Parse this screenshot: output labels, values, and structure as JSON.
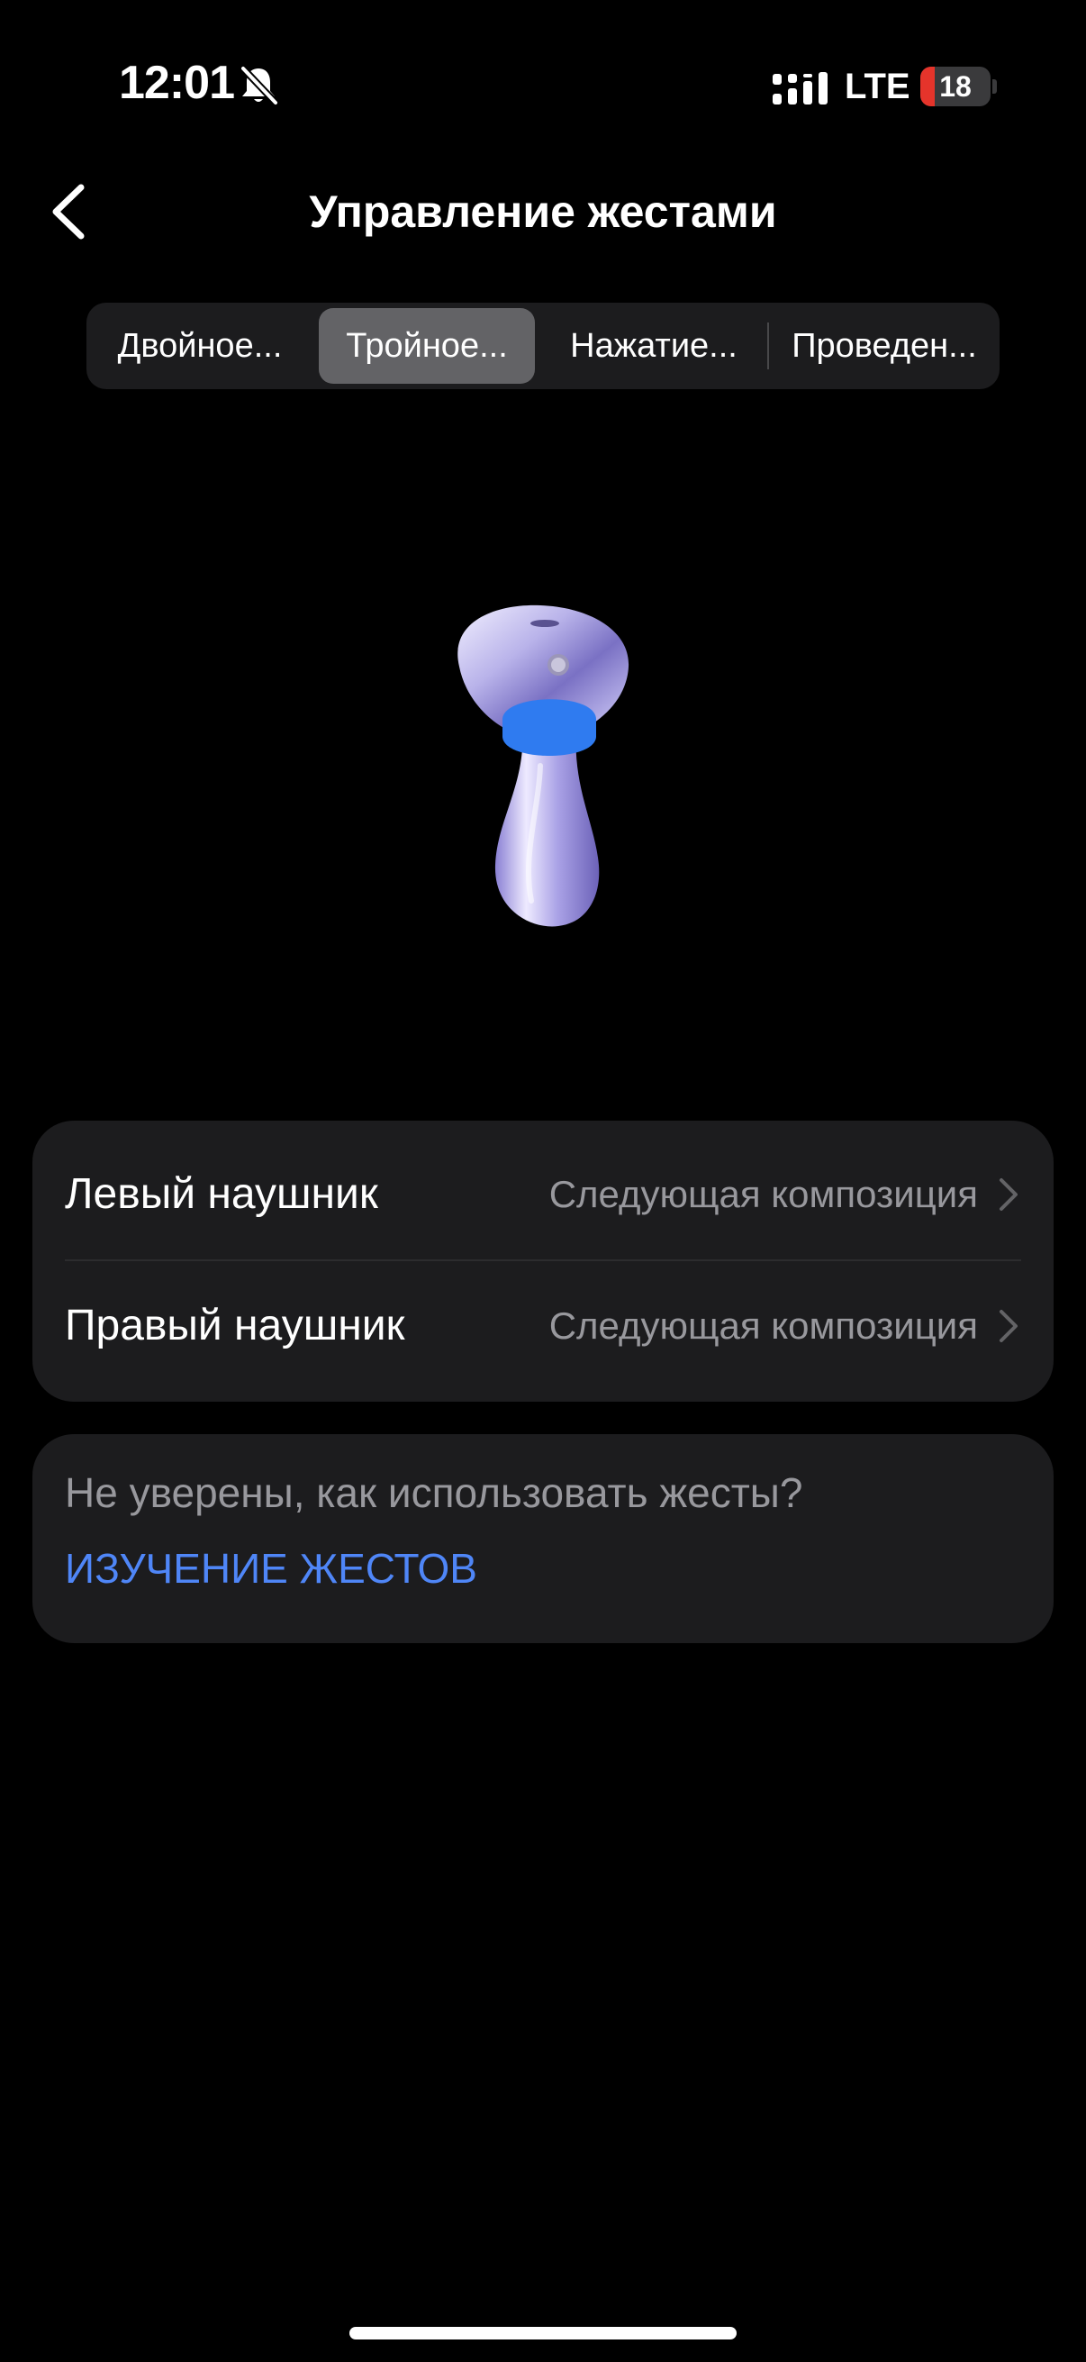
{
  "status_bar": {
    "time": "12:01",
    "network": "LTE",
    "battery_level": "18",
    "battery_color": "#e5342b"
  },
  "nav": {
    "back_icon": "chevron-left-icon",
    "title": "Управление жестами"
  },
  "tabs": [
    {
      "label": "Двойное...",
      "active": false
    },
    {
      "label": "Тройное...",
      "active": true
    },
    {
      "label": "Нажатие...",
      "active": false
    },
    {
      "label": "Проведен...",
      "active": false
    }
  ],
  "illustration": {
    "icon": "earbud-illustration",
    "highlight_color": "#2f7bf0"
  },
  "settings": {
    "left_earbud": {
      "label": "Левый наушник",
      "value": "Следующая композиция"
    },
    "right_earbud": {
      "label": "Правый наушник",
      "value": "Следующая композиция"
    }
  },
  "help": {
    "question": "Не уверены, как использовать жесты?",
    "link": "ИЗУЧЕНИЕ ЖЕСТОВ",
    "link_color": "#4f86f7"
  }
}
